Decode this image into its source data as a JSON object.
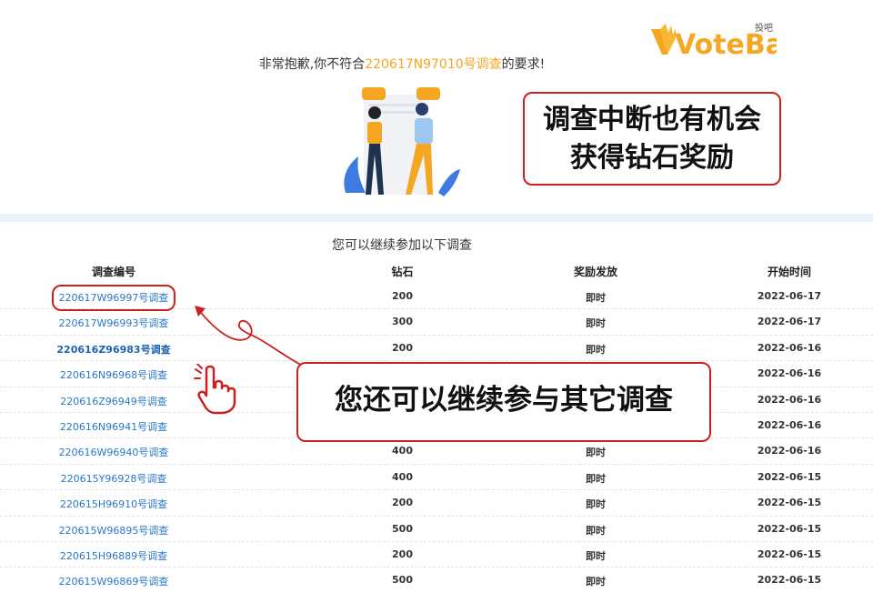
{
  "logo": {
    "text": "VoteBar",
    "small_text": "投吧"
  },
  "notice": {
    "prefix": "非常抱歉,你不符合",
    "survey_code": "220617N97010号调查",
    "suffix": "的要求!"
  },
  "callouts": {
    "top_line1": "调查中断也有机会",
    "top_line2": "获得钻石奖励",
    "bottom": "您还可以继续参与其它调查"
  },
  "list_title": "您可以继续参加以下调查",
  "table": {
    "headers": [
      "调查编号",
      "钻石",
      "奖励发放",
      "开始时间"
    ],
    "rows": [
      {
        "id": "220617W96997号调查",
        "diamonds": "200",
        "reward": "即时",
        "date": "2022-06-17"
      },
      {
        "id": "220617W96993号调查",
        "diamonds": "300",
        "reward": "即时",
        "date": "2022-06-17"
      },
      {
        "id": "220616Z96983号调查",
        "diamonds": "200",
        "reward": "即时",
        "date": "2022-06-16"
      },
      {
        "id": "220616N96968号调查",
        "diamonds": "",
        "reward": "",
        "date": "2022-06-16"
      },
      {
        "id": "220616Z96949号调查",
        "diamonds": "",
        "reward": "",
        "date": "2022-06-16"
      },
      {
        "id": "220616N96941号调查",
        "diamonds": "",
        "reward": "",
        "date": "2022-06-16"
      },
      {
        "id": "220616W96940号调查",
        "diamonds": "400",
        "reward": "即时",
        "date": "2022-06-16"
      },
      {
        "id": "220615Y96928号调查",
        "diamonds": "400",
        "reward": "即时",
        "date": "2022-06-15"
      },
      {
        "id": "220615H96910号调查",
        "diamonds": "200",
        "reward": "即时",
        "date": "2022-06-15"
      },
      {
        "id": "220615W96895号调查",
        "diamonds": "500",
        "reward": "即时",
        "date": "2022-06-15"
      },
      {
        "id": "220615H96889号调查",
        "diamonds": "200",
        "reward": "即时",
        "date": "2022-06-15"
      },
      {
        "id": "220615W96869号调查",
        "diamonds": "500",
        "reward": "即时",
        "date": "2022-06-15"
      }
    ]
  },
  "colors": {
    "accent": "#f5a623",
    "link": "#2a78c8",
    "callout_border": "#cc1f1f"
  }
}
